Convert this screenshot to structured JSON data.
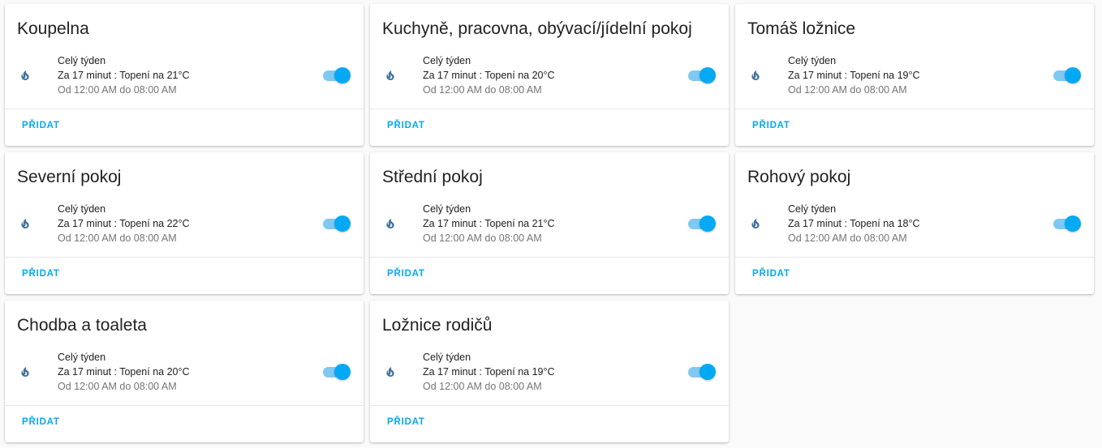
{
  "colors": {
    "accent": "#03a9f4",
    "flame": "#44739e",
    "background": "#fafafa"
  },
  "cards": [
    {
      "title": "Koupelna",
      "schedule": {
        "days": "Celý týden",
        "summary": "Za 17 minut : Topení na 21°C",
        "time": "Od 12:00 AM do 08:00 AM",
        "enabled": true
      },
      "add_label": "PŘIDAT"
    },
    {
      "title": "Kuchyně, pracovna, obývací/jídelní pokoj",
      "schedule": {
        "days": "Celý týden",
        "summary": "Za 17 minut : Topení na 20°C",
        "time": "Od 12:00 AM do 08:00 AM",
        "enabled": true
      },
      "add_label": "PŘIDAT"
    },
    {
      "title": "Tomáš ložnice",
      "schedule": {
        "days": "Celý týden",
        "summary": "Za 17 minut : Topení na 19°C",
        "time": "Od 12:00 AM do 08:00 AM",
        "enabled": true
      },
      "add_label": "PŘIDAT"
    },
    {
      "title": "Severní pokoj",
      "schedule": {
        "days": "Celý týden",
        "summary": "Za 17 minut : Topení na 22°C",
        "time": "Od 12:00 AM do 08:00 AM",
        "enabled": true
      },
      "add_label": "PŘIDAT"
    },
    {
      "title": "Střední pokoj",
      "schedule": {
        "days": "Celý týden",
        "summary": "Za 17 minut : Topení na 21°C",
        "time": "Od 12:00 AM do 08:00 AM",
        "enabled": true
      },
      "add_label": "PŘIDAT"
    },
    {
      "title": "Rohový pokoj",
      "schedule": {
        "days": "Celý týden",
        "summary": "Za 17 minut : Topení na 18°C",
        "time": "Od 12:00 AM do 08:00 AM",
        "enabled": true
      },
      "add_label": "PŘIDAT"
    },
    {
      "title": "Chodba a toaleta",
      "schedule": {
        "days": "Celý týden",
        "summary": "Za 17 minut : Topení na 20°C",
        "time": "Od 12:00 AM do 08:00 AM",
        "enabled": true
      },
      "add_label": "PŘIDAT"
    },
    {
      "title": "Ložnice rodičů",
      "schedule": {
        "days": "Celý týden",
        "summary": "Za 17 minut : Topení na 19°C",
        "time": "Od 12:00 AM do 08:00 AM",
        "enabled": true
      },
      "add_label": "PŘIDAT"
    }
  ]
}
